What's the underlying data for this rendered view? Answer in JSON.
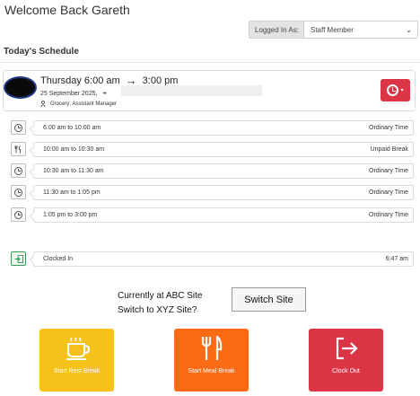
{
  "header": {
    "welcome": "Welcome Back Gareth",
    "logged_in_label": "Logged In As:",
    "logged_in_value": "Staff Member"
  },
  "schedule": {
    "title": "Today's Schedule",
    "shift": {
      "start": "Thursday 6:00 am",
      "end": "3:00 pm",
      "date": "25 September 2025,",
      "role": "Grocery: Assistant Manager"
    },
    "segments": [
      {
        "time": "6:00 am to 10:00 am",
        "type": "Ordinary Time",
        "icon": "clock-icon"
      },
      {
        "time": "10:00 am to 10:30 am",
        "type": "Unpaid Break",
        "icon": "fork-knife-icon"
      },
      {
        "time": "10:30 am to 11:30 am",
        "type": "Ordinary Time",
        "icon": "clock-icon"
      },
      {
        "time": "11:30 am to 1:05 pm",
        "type": "Ordinary Time",
        "icon": "clock-icon"
      },
      {
        "time": "1:05 pm to 3:00 pm",
        "type": "Ordinary Time",
        "icon": "clock-icon"
      }
    ],
    "clocked": {
      "label": "Clocked In",
      "time": "6:47 am"
    }
  },
  "site": {
    "line1": "Currently at ABC Site",
    "line2": "Switch to XYZ Site?",
    "switch_label": "Switch Site"
  },
  "actions": {
    "rest_label": "Start Rest Break",
    "meal_label": "Start Meal Break",
    "out_label": "Clock Out"
  },
  "colors": {
    "rest": "#f6c11a",
    "meal": "#fb6a15",
    "clock_out": "#dc3545"
  }
}
